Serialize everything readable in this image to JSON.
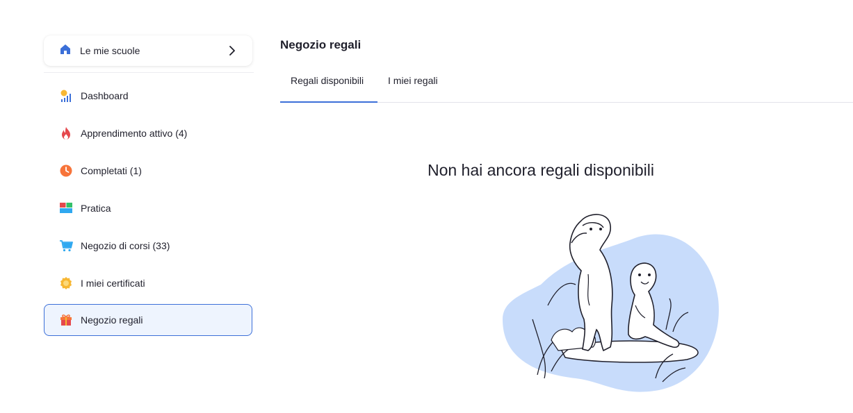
{
  "sidebar": {
    "schools_label": "Le mie scuole",
    "items": [
      {
        "label": "Dashboard",
        "icon": "dashboard-chart-icon"
      },
      {
        "label": "Apprendimento attivo (4)",
        "icon": "flame-icon"
      },
      {
        "label": "Completati (1)",
        "icon": "clock-icon"
      },
      {
        "label": "Pratica",
        "icon": "grid-blocks-icon"
      },
      {
        "label": "Negozio di corsi (33)",
        "icon": "cart-icon"
      },
      {
        "label": "I miei certificati",
        "icon": "medal-icon"
      },
      {
        "label": "Negozio regali",
        "icon": "gift-icon"
      }
    ]
  },
  "main": {
    "title": "Negozio regali",
    "tabs": [
      {
        "label": "Regali disponibili"
      },
      {
        "label": "I miei regali"
      }
    ],
    "empty_message": "Non hai ancora regali disponibili"
  },
  "colors": {
    "accent": "#3b6fd8",
    "active_bg": "#eef4fe",
    "blob": "#c8dcfb"
  }
}
